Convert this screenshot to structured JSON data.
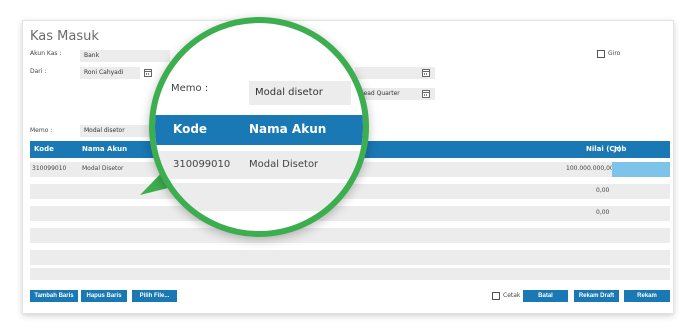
{
  "form": {
    "title": "Kas Masuk",
    "akun_kas_label": "Akun Kas :",
    "akun_kas_value": "Bank",
    "dari_label": "Dari :",
    "dari_value": "Roni Cahyadi",
    "gudang_value": "Head Quarter",
    "memo_label": "Memo :",
    "memo_value": "Modal disetor",
    "giro_label": "Giro"
  },
  "table": {
    "columns": {
      "kode": "Kode",
      "nama_akun": "Nama Akun",
      "nilai": "Nilai (Cr)",
      "job": "Job"
    },
    "rows": [
      {
        "kode": "310099010",
        "nama_akun": "Modal Disetor",
        "mid": "",
        "nilai": "100.000.000,00"
      },
      {
        "kode": "",
        "nama_akun": "",
        "mid": "",
        "nilai": "0,00"
      },
      {
        "kode": "",
        "nama_akun": "",
        "mid": "99",
        "nilai": "0,00"
      }
    ]
  },
  "footer": {
    "tambah_baris": "Tambah Baris",
    "hapus_baris": "Hapus Baris",
    "pilih_file": "Pilih File...",
    "cetak_label": "Cetak",
    "batal": "Batal",
    "rekam_draft": "Rekam Draft",
    "rekam": "Rekam"
  },
  "zoom": {
    "memo_label": "Memo :",
    "memo_value": "Modal disetor",
    "kode_header": "Kode",
    "nama_akun_header": "Nama Akun",
    "row_kode": "310099010",
    "row_nama": "Modal Disetor"
  },
  "colors": {
    "accent": "#1a78b4",
    "highlight": "#3dae4f",
    "job_cell": "#7dc3ea"
  }
}
